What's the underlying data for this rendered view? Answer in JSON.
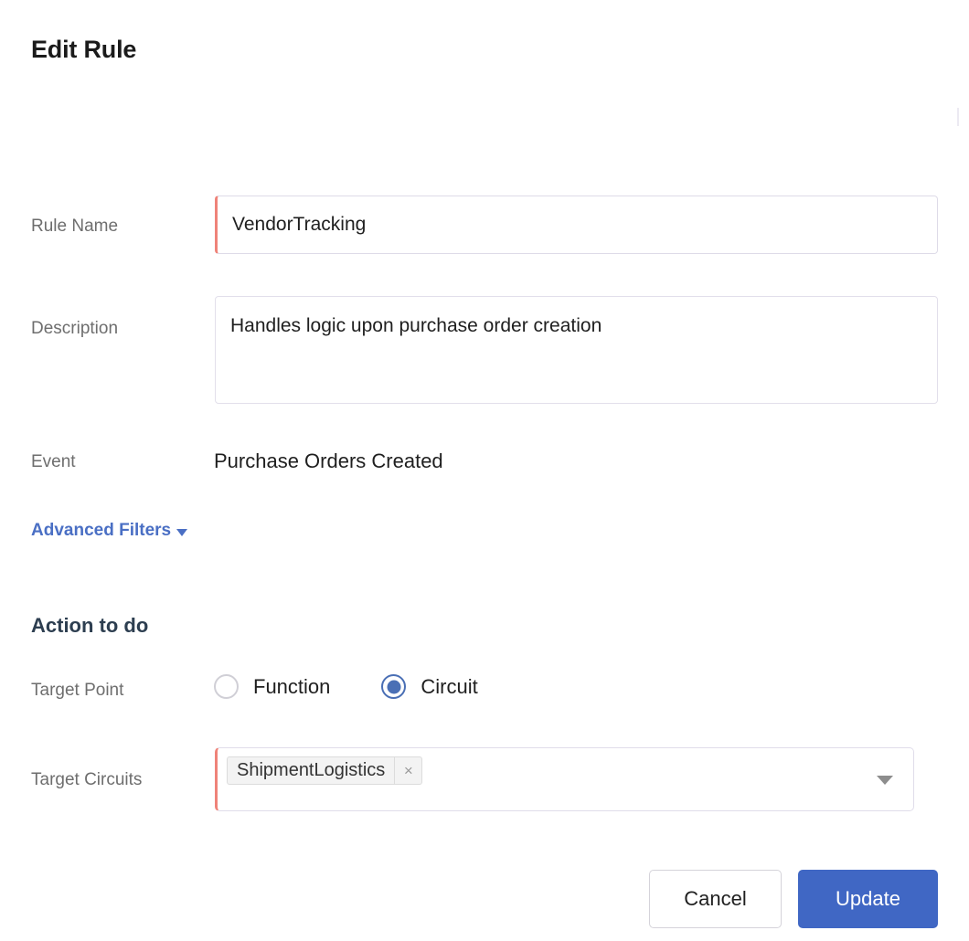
{
  "page": {
    "title": "Edit Rule"
  },
  "form": {
    "rule_name": {
      "label": "Rule Name",
      "value": "VendorTracking",
      "placeholder": "Rule Name",
      "required": true
    },
    "description": {
      "label": "Description",
      "value": "Handles logic upon purchase order creation",
      "placeholder": "Description",
      "required": false
    },
    "event": {
      "label": "Event",
      "value": "Purchase Orders Created"
    },
    "advanced_filters": {
      "label": "Advanced Filters",
      "caret": "chevron-down-icon"
    }
  },
  "action_section": {
    "title": "Action to do",
    "target_point": {
      "label": "Target Point",
      "options": [
        {
          "label": "Function",
          "selected": false
        },
        {
          "label": "Circuit",
          "selected": true
        }
      ],
      "selected_value": "Circuit"
    },
    "target_circuits": {
      "label": "Target Circuits",
      "required": true,
      "tags": [
        {
          "label": "ShipmentLogistics",
          "remove_icon": "close-icon",
          "remove_glyph": "×"
        }
      ],
      "caret": "chevron-down-icon"
    }
  },
  "footer": {
    "cancel_label": "Cancel",
    "update_label": "Update"
  },
  "colors": {
    "accent_blue": "#4067c4",
    "link_blue": "#4a6fc4",
    "radio_blue": "#4a6fb5",
    "required_marker": "#ef8379",
    "section_heading": "#2d3e50",
    "label_gray": "#6e6e6e",
    "input_border": "#dedbe8",
    "tag_background": "#f3f3f3"
  }
}
